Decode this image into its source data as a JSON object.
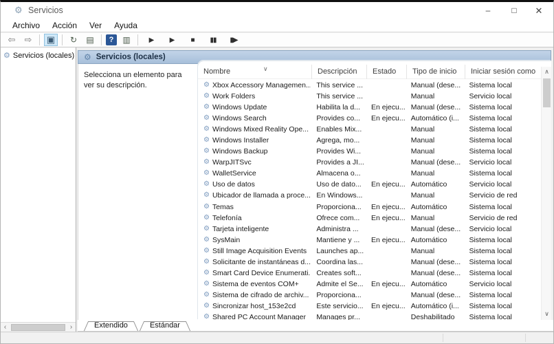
{
  "window": {
    "title": "Servicios"
  },
  "window_controls": {
    "minimize": "–",
    "maximize": "□",
    "close": "✕"
  },
  "menu": {
    "items": [
      "Archivo",
      "Acción",
      "Ver",
      "Ayuda"
    ]
  },
  "icons": {
    "gear": "⚙",
    "scroll_up": "∧",
    "scroll_down": "∨",
    "scroll_left": "‹",
    "scroll_right": "›"
  },
  "toolbar": {
    "items": [
      {
        "type": "icon",
        "name": "back-icon",
        "glyph": "⇦"
      },
      {
        "type": "icon",
        "name": "forward-icon",
        "glyph": "⇨"
      },
      {
        "type": "sep"
      },
      {
        "type": "icon",
        "name": "show-console-tree-icon",
        "glyph": "▣",
        "active": true
      },
      {
        "type": "sep"
      },
      {
        "type": "icon",
        "name": "refresh-icon",
        "glyph": "↻",
        "style": "dark"
      },
      {
        "type": "icon",
        "name": "export-list-icon",
        "glyph": "▤",
        "style": "dark"
      },
      {
        "type": "sep"
      },
      {
        "type": "icon",
        "name": "help-icon",
        "glyph": "?",
        "style": "help"
      },
      {
        "type": "icon",
        "name": "show-action-pane-icon",
        "glyph": "▥",
        "style": "dark"
      },
      {
        "type": "sep"
      },
      {
        "type": "icon",
        "name": "start-service-icon",
        "glyph": "▶",
        "style": "media"
      },
      {
        "type": "icon",
        "name": "resume-service-icon",
        "glyph": "▶",
        "style": "media"
      },
      {
        "type": "icon",
        "name": "stop-service-icon",
        "glyph": "■",
        "style": "media"
      },
      {
        "type": "icon",
        "name": "pause-service-icon",
        "glyph": "▮▮",
        "style": "media"
      },
      {
        "type": "icon",
        "name": "restart-service-icon",
        "glyph": "▮▶",
        "style": "media"
      }
    ]
  },
  "sidebar": {
    "root_label": "Servicios (locales)"
  },
  "content": {
    "header_title": "Servicios (locales)",
    "description_hint": "Selecciona un elemento para ver su descripción."
  },
  "table": {
    "columns": [
      "Nombre",
      "Descripción",
      "Estado",
      "Tipo de inicio",
      "Iniciar sesión como"
    ],
    "sort_indicator": "∨",
    "rows": [
      {
        "name": "Xbox Accessory Managemen...",
        "description": "This service ...",
        "status": "",
        "startup": "Manual (dese...",
        "logon": "Sistema local"
      },
      {
        "name": "Work Folders",
        "description": "This service ...",
        "status": "",
        "startup": "Manual",
        "logon": "Servicio local"
      },
      {
        "name": "Windows Update",
        "description": "Habilita la d...",
        "status": "En ejecu...",
        "startup": "Manual (dese...",
        "logon": "Sistema local"
      },
      {
        "name": "Windows Search",
        "description": "Provides co...",
        "status": "En ejecu...",
        "startup": "Automático (i...",
        "logon": "Sistema local"
      },
      {
        "name": "Windows Mixed Reality Ope...",
        "description": "Enables Mix...",
        "status": "",
        "startup": "Manual",
        "logon": "Sistema local"
      },
      {
        "name": "Windows Installer",
        "description": "Agrega, mo...",
        "status": "",
        "startup": "Manual",
        "logon": "Sistema local"
      },
      {
        "name": "Windows Backup",
        "description": "Provides Wi...",
        "status": "",
        "startup": "Manual",
        "logon": "Sistema local"
      },
      {
        "name": "WarpJITSvc",
        "description": "Provides a JI...",
        "status": "",
        "startup": "Manual (dese...",
        "logon": "Servicio local"
      },
      {
        "name": "WalletService",
        "description": "Almacena o...",
        "status": "",
        "startup": "Manual",
        "logon": "Sistema local"
      },
      {
        "name": "Uso de datos",
        "description": "Uso de dato...",
        "status": "En ejecu...",
        "startup": "Automático",
        "logon": "Servicio local"
      },
      {
        "name": "Ubicador de llamada a proce...",
        "description": "En Windows...",
        "status": "",
        "startup": "Manual",
        "logon": "Servicio de red"
      },
      {
        "name": "Temas",
        "description": "Proporciona...",
        "status": "En ejecu...",
        "startup": "Automático",
        "logon": "Sistema local"
      },
      {
        "name": "Telefonía",
        "description": "Ofrece com...",
        "status": "En ejecu...",
        "startup": "Manual",
        "logon": "Servicio de red"
      },
      {
        "name": "Tarjeta inteligente",
        "description": "Administra ...",
        "status": "",
        "startup": "Manual (dese...",
        "logon": "Servicio local"
      },
      {
        "name": "SysMain",
        "description": "Mantiene y ...",
        "status": "En ejecu...",
        "startup": "Automático",
        "logon": "Sistema local"
      },
      {
        "name": "Still Image Acquisition Events",
        "description": "Launches ap...",
        "status": "",
        "startup": "Manual",
        "logon": "Sistema local"
      },
      {
        "name": "Solicitante de instantáneas d...",
        "description": "Coordina las...",
        "status": "",
        "startup": "Manual (dese...",
        "logon": "Sistema local"
      },
      {
        "name": "Smart Card Device Enumerati...",
        "description": "Creates soft...",
        "status": "",
        "startup": "Manual (dese...",
        "logon": "Sistema local"
      },
      {
        "name": "Sistema de eventos COM+",
        "description": "Admite el Se...",
        "status": "En ejecu...",
        "startup": "Automático",
        "logon": "Servicio local"
      },
      {
        "name": "Sistema de cifrado de archiv...",
        "description": "Proporciona...",
        "status": "",
        "startup": "Manual (dese...",
        "logon": "Sistema local"
      },
      {
        "name": "Sincronizar host_153e2cd",
        "description": "Este servicio...",
        "status": "En ejecu...",
        "startup": "Automático (i...",
        "logon": "Sistema local"
      },
      {
        "name": "Shared PC Account Manager",
        "description": "Manages pr...",
        "status": "",
        "startup": "Deshabilitado",
        "logon": "Sistema local"
      }
    ]
  },
  "tabs": {
    "items": [
      "Extendido",
      "Estándar"
    ],
    "active": "Extendido"
  },
  "colors": {
    "band": "#b3c9e2",
    "band_border": "#8ba6c1",
    "help_blue": "#2b5797",
    "toolbar_active_bg": "#cfe8f8",
    "status_bar": "#f1f1f1"
  }
}
